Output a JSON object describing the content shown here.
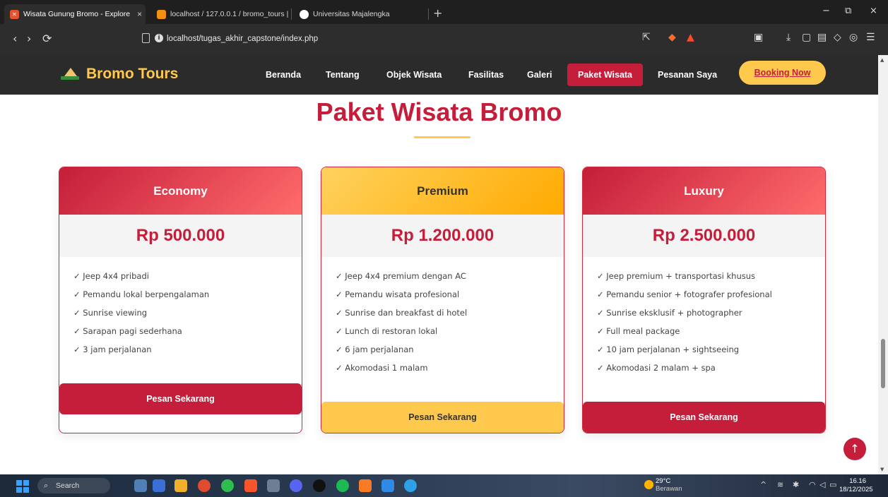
{
  "browser": {
    "tabs": [
      {
        "title": "Wisata Gunung Bromo - Explore",
        "close": "×"
      },
      {
        "title": "localhost / 127.0.0.1 / bromo_tours |"
      },
      {
        "title": "Universitas Majalengka"
      }
    ],
    "new_tab": "+",
    "url": "localhost/tugas_akhir_capstone/index.php",
    "window_controls": {
      "minimize": "−",
      "maximize": "⧉",
      "close": "×"
    },
    "nav_icons": {
      "back": "‹",
      "forward": "›",
      "reload": "⟳"
    }
  },
  "site": {
    "logo_text": "Bromo Tours",
    "nav": [
      {
        "label": "Beranda"
      },
      {
        "label": "Tentang"
      },
      {
        "label": "Objek Wisata"
      },
      {
        "label": "Fasilitas"
      },
      {
        "label": "Galeri"
      },
      {
        "label": "Paket Wisata",
        "active": true
      },
      {
        "label": "Pesanan Saya"
      }
    ],
    "booking_label": "Booking Now",
    "section_title": "Paket Wisata Bromo",
    "packages": [
      {
        "name": "Economy",
        "price": "Rp 500.000",
        "features": [
          "✓ Jeep 4x4 pribadi",
          "✓ Pemandu lokal berpengalaman",
          "✓ Sunrise viewing",
          "✓ Sarapan pagi sederhana",
          "✓ 3 jam perjalanan"
        ],
        "button": "Pesan Sekarang"
      },
      {
        "name": "Premium",
        "price": "Rp 1.200.000",
        "features": [
          "✓ Jeep 4x4 premium dengan AC",
          "✓ Pemandu wisata profesional",
          "✓ Sunrise dan breakfast di hotel",
          "✓ Lunch di restoran lokal",
          "✓ 6 jam perjalanan",
          "✓ Akomodasi 1 malam"
        ],
        "button": "Pesan Sekarang"
      },
      {
        "name": "Luxury",
        "price": "Rp 2.500.000",
        "features": [
          "✓ Jeep premium + transportasi khusus",
          "✓ Pemandu senior + fotografer profesional",
          "✓ Sunrise eksklusif + photographer",
          "✓ Full meal package",
          "✓ 10 jam perjalanan + sightseeing",
          "✓ Akomodasi 2 malam + spa"
        ],
        "button": "Pesan Sekarang"
      }
    ],
    "back_to_top": "↑"
  },
  "taskbar": {
    "search_label": "Search",
    "weather_temp": "29°C",
    "weather_desc": "Berawan",
    "time": "16.16",
    "date": "18/12/2025"
  },
  "colors": {
    "brand_red": "#c41e3a",
    "brand_gold": "#ffc94d",
    "navbar_bg": "#2b2b2b"
  }
}
